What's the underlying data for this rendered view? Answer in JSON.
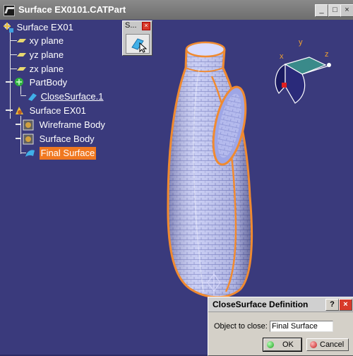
{
  "window": {
    "title": "Surface EX0101.CATPart",
    "buttons": {
      "minimize": "_",
      "maximize": "□",
      "close": "×"
    }
  },
  "tree": {
    "root": "Surface EX01",
    "planes": [
      "xy plane",
      "yz plane",
      "zx plane"
    ],
    "partbody": "PartBody",
    "partbody_child": "CloseSurface.1",
    "geoset": "Surface EX01",
    "geoset_children": [
      "Wireframe Body",
      "Surface Body",
      "Final Surface"
    ]
  },
  "toolbar": {
    "title": "S...",
    "close": "×",
    "tool_icon": "close-surface-icon"
  },
  "compass": {
    "x": "x",
    "y": "y",
    "z": "z"
  },
  "dialog": {
    "title": "CloseSurface Definition",
    "help": "?",
    "close": "×",
    "field_label": "Object to close:",
    "field_value": "Final Surface",
    "ok": "OK",
    "cancel": "Cancel"
  },
  "colors": {
    "background": "#3a3a7c",
    "selection": "#f07820",
    "surface": "#c6ccf5",
    "edge": "#f08a30"
  }
}
